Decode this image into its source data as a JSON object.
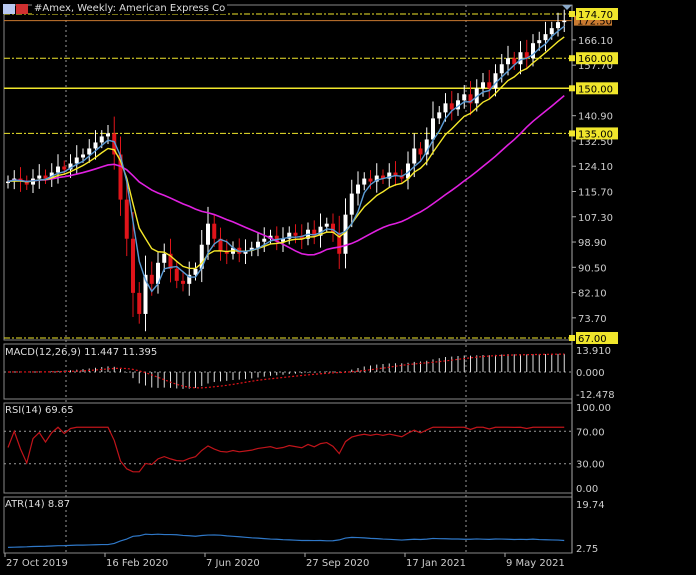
{
  "header": {
    "title": "#Amex, Weekly:  American Express Co"
  },
  "colors": {
    "bull": "#ffffff",
    "bear": "#e0141a",
    "ma_fast": "#5b9bd5",
    "ma_mid": "#f5e82a",
    "ma_slow": "#e020e0",
    "level": "#f0e62c",
    "bid": "#c97a30",
    "macd_signal": "#e0141a",
    "rsi": "#c0141a",
    "atr": "#2f78c8",
    "grid": "#9a9a9a"
  },
  "icons": [
    "chart-window-icon",
    "flag-icon"
  ],
  "price_axis": {
    "ticks": [
      "166.10",
      "157.70",
      "140.90",
      "132.50",
      "124.10",
      "115.70",
      "107.30",
      "98.90",
      "90.50",
      "82.10",
      "73.70"
    ],
    "levels": [
      {
        "label": "174.70",
        "style": "dash-dot"
      },
      {
        "label": "160.00",
        "style": "dash-dot"
      },
      {
        "label": "150.00",
        "style": "solid"
      },
      {
        "label": "135.00",
        "style": "dash-dot"
      },
      {
        "label": "67.00",
        "style": "dash-dot"
      }
    ],
    "bid_label": "172.50"
  },
  "macd": {
    "label": "MACD(12,26,9) 11.447 11.395",
    "ticks": [
      "13.910",
      "0.000",
      "-12.478"
    ]
  },
  "rsi": {
    "label": "RSI(14) 69.65",
    "ticks": [
      "100.00",
      "70.00",
      "30.00",
      "0.00"
    ]
  },
  "atr": {
    "label": "ATR(14) 8.87",
    "ticks": [
      "19.74",
      "2.75"
    ]
  },
  "time_axis": {
    "ticks": [
      "27 Oct 2019",
      "16 Feb 2020",
      "7 Jun 2020",
      "27 Sep 2020",
      "17 Jan 2021",
      "9 May 2021"
    ]
  },
  "chart_data": {
    "type": "candlestick",
    "timeframe": "Weekly",
    "start": "27 Oct 2019",
    "ylim": [
      67,
      174.7
    ],
    "close": [
      119,
      120,
      119,
      118,
      120,
      121,
      120,
      122,
      124,
      123,
      125,
      127,
      128,
      130,
      132,
      134,
      135,
      128,
      113,
      100,
      82,
      75,
      88,
      85,
      92,
      95,
      90,
      86,
      85,
      88,
      90,
      98,
      105,
      100,
      96,
      95,
      97,
      95,
      96,
      97,
      99,
      100,
      101,
      99,
      100,
      102,
      101,
      100,
      103,
      101,
      104,
      105,
      102,
      95,
      108,
      115,
      118,
      120,
      119,
      121,
      120,
      122,
      121,
      120,
      125,
      130,
      128,
      133,
      140,
      142,
      145,
      143,
      146,
      148,
      145,
      150,
      152,
      150,
      155,
      158,
      160,
      158,
      162,
      160,
      165,
      166,
      168,
      170,
      172,
      172.5
    ]
  }
}
